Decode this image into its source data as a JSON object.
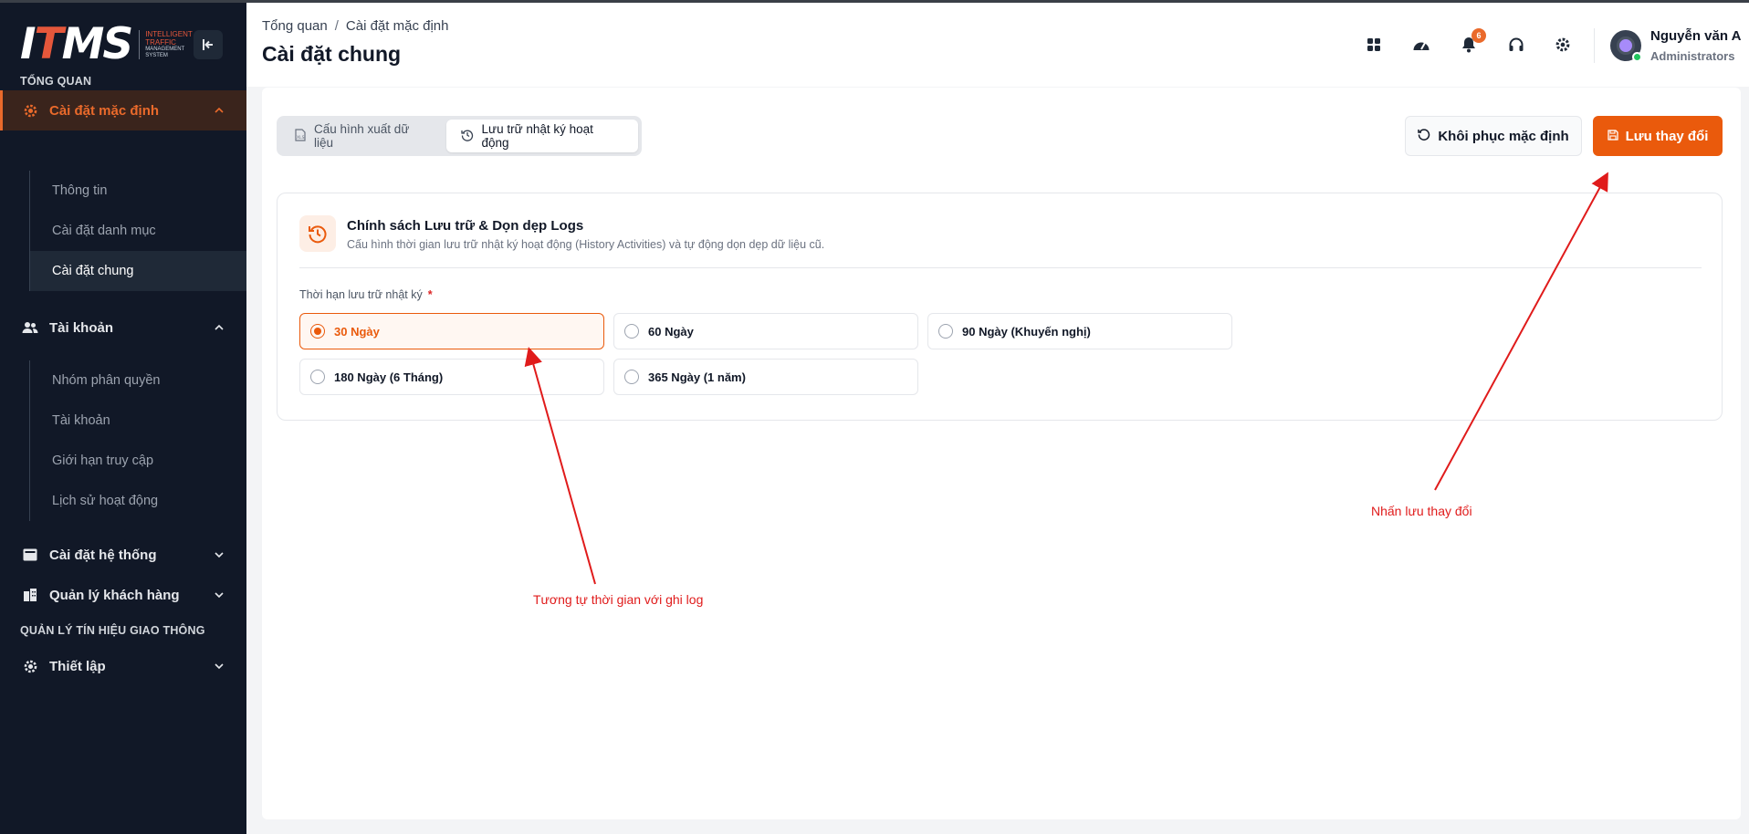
{
  "logo": {
    "mark": "ITMS",
    "line1": "INTELLIGENT",
    "line2": "TRAFFIC",
    "line3": "MANAGEMENT SYSTEM"
  },
  "sidebar": {
    "section_overview": "TỔNG QUAN",
    "groups": [
      {
        "label": "Cài đặt mặc định",
        "icon": "gear-icon",
        "expanded": true,
        "active": true,
        "items": [
          {
            "label": "Thông tin"
          },
          {
            "label": "Cài đặt danh mục"
          },
          {
            "label": "Cài đặt chung",
            "active": true
          }
        ]
      },
      {
        "label": "Tài khoản",
        "icon": "users-icon",
        "expanded": true,
        "items": [
          {
            "label": "Nhóm phân quyền"
          },
          {
            "label": "Tài khoản"
          },
          {
            "label": "Giới hạn truy cập"
          },
          {
            "label": "Lịch sử hoạt động"
          }
        ]
      },
      {
        "label": "Cài đặt hệ thống",
        "icon": "system-icon",
        "expanded": false
      },
      {
        "label": "Quản lý khách hàng",
        "icon": "building-icon",
        "expanded": false
      }
    ],
    "section_traffic": "QUẢN LÝ TÍN HIỆU GIAO THÔNG",
    "setup": {
      "label": "Thiết lập",
      "icon": "gear-icon",
      "expanded": false
    }
  },
  "header": {
    "breadcrumb": [
      "Tổng quan",
      "Cài đặt mặc định"
    ],
    "breadcrumb_sep": "/",
    "title": "Cài đặt chung",
    "notification_count": "6",
    "user": {
      "name": "Nguyễn văn A",
      "role": "Administrators"
    }
  },
  "tabs": [
    {
      "label": "Cấu hình xuất dữ liệu",
      "icon": "xls-icon",
      "active": false
    },
    {
      "label": "Lưu trữ nhật ký hoạt động",
      "icon": "history-icon",
      "active": true
    }
  ],
  "actions": {
    "reset_label": "Khôi phục mặc định",
    "save_label": "Lưu thay đổi"
  },
  "card": {
    "title": "Chính sách Lưu trữ & Dọn dẹp Logs",
    "description": "Cấu hình thời gian lưu trữ nhật ký hoạt động (History Activities) và tự động dọn dẹp dữ liệu cũ.",
    "field_label": "Thời hạn lưu trữ nhật ký",
    "required_mark": "*",
    "options": [
      {
        "label": "30 Ngày",
        "selected": true
      },
      {
        "label": "60 Ngày",
        "selected": false
      },
      {
        "label": "90 Ngày (Khuyến nghị)",
        "selected": false
      },
      {
        "label": "180 Ngày (6 Tháng)",
        "selected": false
      },
      {
        "label": "365 Ngày (1 năm)",
        "selected": false
      }
    ]
  },
  "annotations": {
    "note_options": "Tương tự thời gian với ghi log",
    "note_save": "Nhấn lưu thay đổi",
    "color": "#e01b1b"
  },
  "colors": {
    "accent": "#ea5a0c",
    "sidebar_bg": "#111827"
  }
}
